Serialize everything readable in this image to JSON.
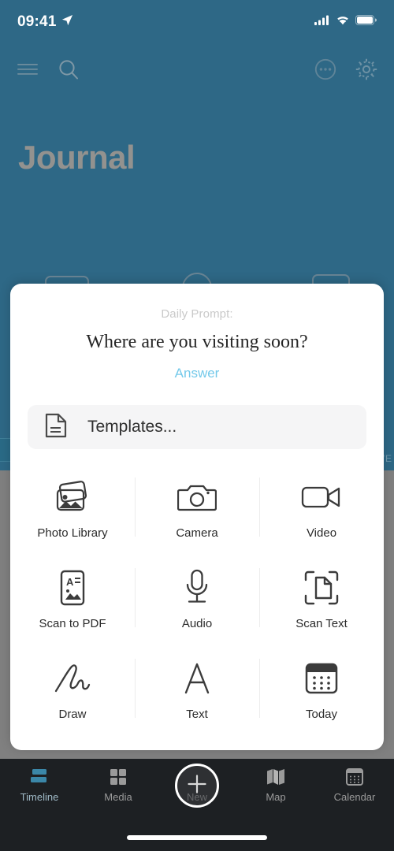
{
  "status_bar": {
    "time": "09:41",
    "location_icon": "location-arrow-icon",
    "cellular_icon": "cellular-bars-icon",
    "wifi_icon": "wifi-icon",
    "battery_icon": "battery-full-icon"
  },
  "nav": {
    "menu_icon": "hamburger-menu-icon",
    "search_icon": "search-icon",
    "more_icon": "ellipsis-circle-icon",
    "settings_icon": "gear-icon"
  },
  "page": {
    "title": "Journal",
    "background_color": "#2e6886",
    "dim_color": "#808080"
  },
  "background_peek": {
    "weekday_label": "WE"
  },
  "sheet": {
    "prompt_label": "Daily Prompt:",
    "prompt_question": "Where are you visiting soon?",
    "answer_link": "Answer",
    "answer_link_color": "#74c9ea",
    "templates": {
      "label": "Templates...",
      "icon": "document-icon"
    },
    "actions": [
      [
        {
          "label": "Photo Library",
          "icon": "photo-library-icon"
        },
        {
          "label": "Camera",
          "icon": "camera-icon"
        },
        {
          "label": "Video",
          "icon": "video-camera-icon"
        }
      ],
      [
        {
          "label": "Scan to PDF",
          "icon": "scan-to-pdf-icon"
        },
        {
          "label": "Audio",
          "icon": "microphone-icon"
        },
        {
          "label": "Scan Text",
          "icon": "scan-text-icon"
        }
      ],
      [
        {
          "label": "Draw",
          "icon": "scribble-draw-icon"
        },
        {
          "label": "Text",
          "icon": "text-letter-a-icon"
        },
        {
          "label": "Today",
          "icon": "calendar-today-icon"
        }
      ]
    ]
  },
  "tabbar": {
    "background_color": "#1d2023",
    "active_color": "#3b87a8",
    "items": [
      {
        "label": "Timeline",
        "icon": "timeline-bars-icon",
        "active": true
      },
      {
        "label": "Media",
        "icon": "grid-squares-icon",
        "active": false
      },
      {
        "label": "New",
        "icon": "plus-icon",
        "active": false
      },
      {
        "label": "Map",
        "icon": "folded-map-icon",
        "active": false
      },
      {
        "label": "Calendar",
        "icon": "calendar-grid-icon",
        "active": false
      }
    ]
  }
}
